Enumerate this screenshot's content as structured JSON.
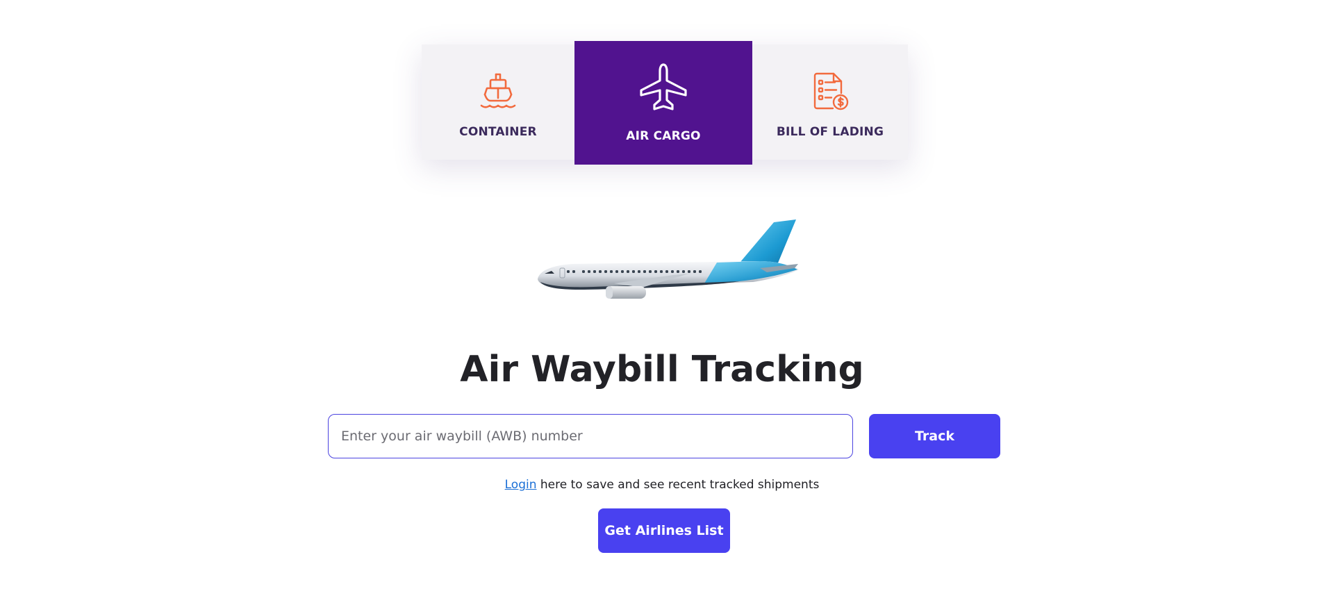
{
  "tabs": {
    "container": {
      "label": "CONTAINER",
      "icon": "ship-icon"
    },
    "air_cargo": {
      "label": "AIR CARGO",
      "icon": "airplane-icon",
      "active": true
    },
    "bill_of_lading": {
      "label": "BILL OF LADING",
      "icon": "invoice-dollar-icon"
    }
  },
  "hero": {
    "image": "airplane-illustration"
  },
  "title": "Air Waybill Tracking",
  "search": {
    "placeholder": "Enter your air waybill (AWB) number",
    "value": "",
    "track_label": "Track"
  },
  "login_note": {
    "link_label": "Login",
    "text": " here to save and see recent tracked shipments"
  },
  "airlines_button_label": "Get Airlines List",
  "colors": {
    "accent_purple": "#51138f",
    "icon_orange": "#f26a3d",
    "button_blue": "#4941f0",
    "link_blue": "#1a6fd6"
  }
}
